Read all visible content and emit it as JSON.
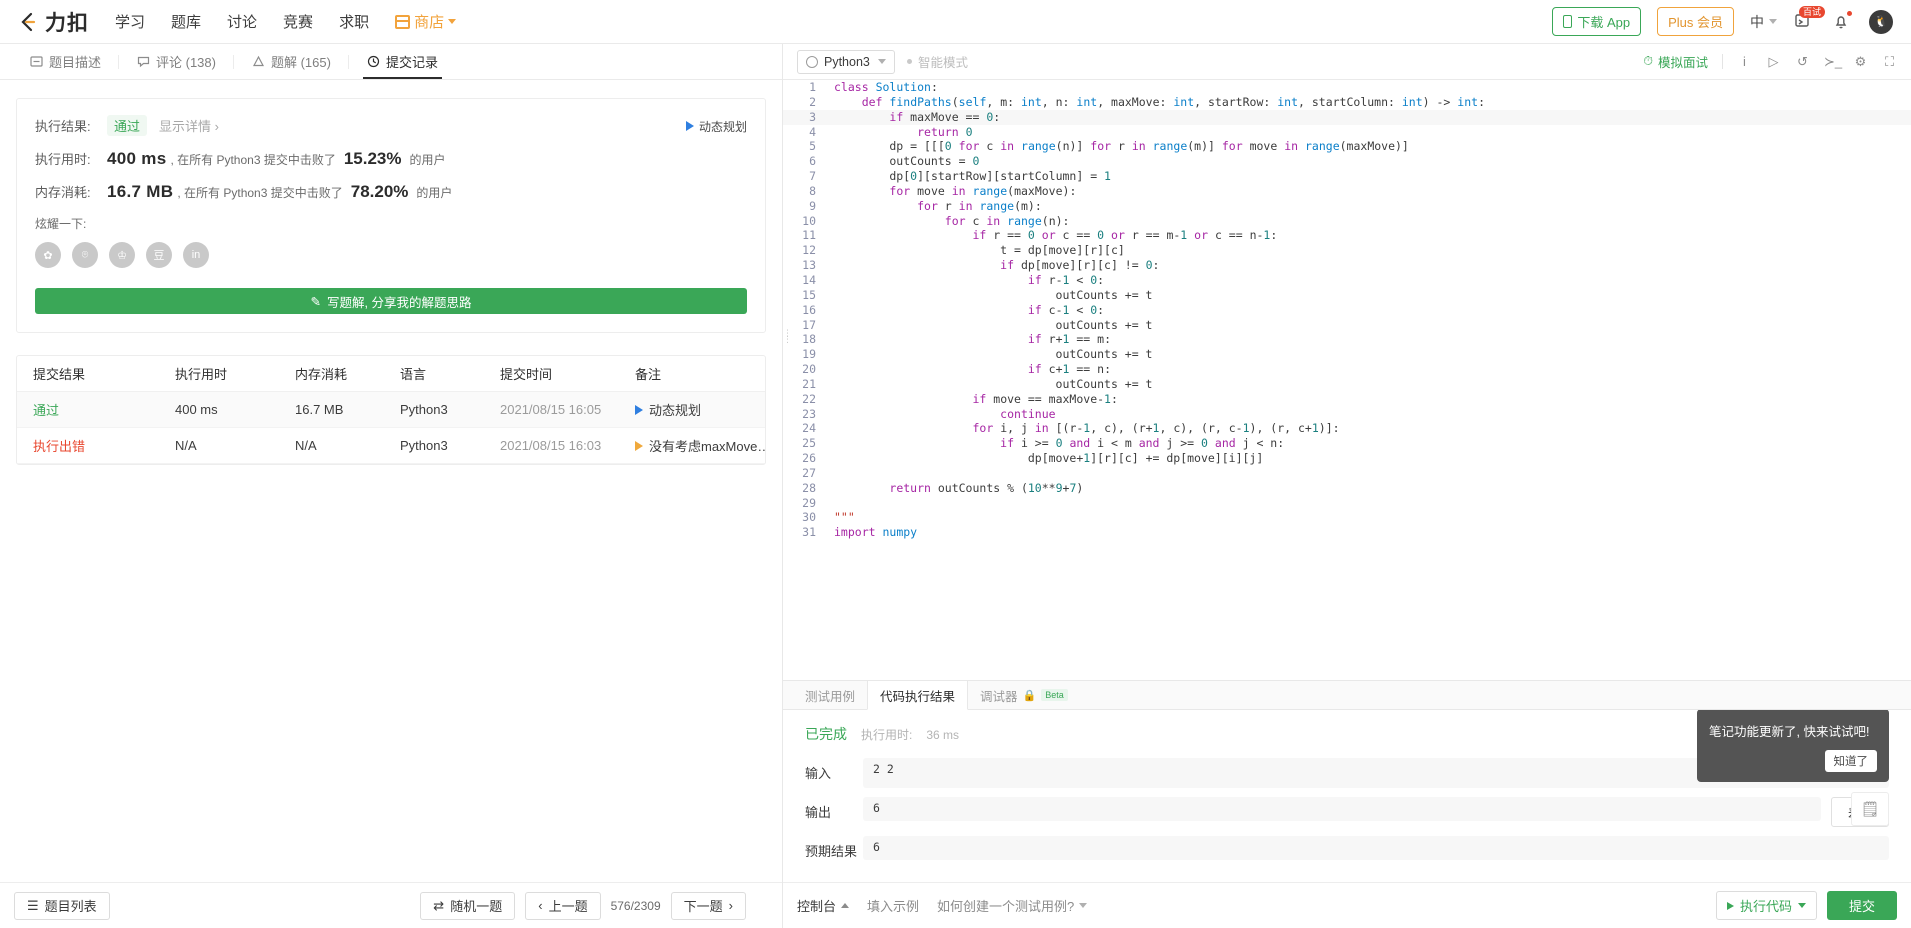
{
  "header": {
    "brand": "力扣",
    "nav": [
      "学习",
      "题库",
      "讨论",
      "竞赛",
      "求职"
    ],
    "shop": "商店",
    "download_app": "下载 App",
    "plus": "Plus 会员",
    "lang": "中",
    "notif_badge": "百试",
    "accent_green": "#3aa757",
    "accent_orange": "#f0a33c"
  },
  "left_tabs": [
    {
      "label": "题目描述",
      "icon": "description-icon",
      "active": false
    },
    {
      "label": "评论 (138)",
      "icon": "comment-icon",
      "active": false
    },
    {
      "label": "题解 (165)",
      "icon": "solution-icon",
      "active": false
    },
    {
      "label": "提交记录",
      "icon": "clock-icon",
      "active": true
    }
  ],
  "result": {
    "result_label": "执行结果:",
    "result_value": "通过",
    "detail_link": "显示详情 ›",
    "time_label": "执行用时:",
    "time_value": "400 ms",
    "time_mid": ", 在所有 Python3 提交中击败了",
    "time_pct": "15.23%",
    "time_suffix": "的用户",
    "mem_label": "内存消耗:",
    "mem_value": "16.7 MB",
    "mem_mid": ", 在所有 Python3 提交中击败了",
    "mem_pct": "78.20%",
    "mem_suffix": "的用户",
    "tag": "动态规划",
    "share_label": "炫耀一下:",
    "share_icons": [
      "wechat-icon",
      "weibo-icon",
      "qq-icon",
      "douban-icon",
      "linkedin-icon"
    ],
    "share_glyphs": [
      "✿",
      "⌾",
      "♔",
      "豆",
      "in"
    ],
    "write_banner": "写题解, 分享我的解题思路"
  },
  "table": {
    "headers": [
      "提交结果",
      "执行用时",
      "内存消耗",
      "语言",
      "提交时间",
      "备注"
    ],
    "rows": [
      {
        "status": "通过",
        "status_type": "pass",
        "runtime": "400 ms",
        "memory": "16.7 MB",
        "language": "Python3",
        "time": "2021/08/15 16:05",
        "note": "动态规划",
        "note_flag": "blue"
      },
      {
        "status": "执行出错",
        "status_type": "error",
        "runtime": "N/A",
        "memory": "N/A",
        "language": "Python3",
        "time": "2021/08/15 16:03",
        "note": "没有考虑maxMove…",
        "note_flag": "orange"
      }
    ]
  },
  "left_footer": {
    "problem_list": "题目列表",
    "random": "随机一题",
    "prev": "上一题",
    "page": "576/2309",
    "next": "下一题"
  },
  "editor": {
    "language": "Python3",
    "smart_mode": "智能模式",
    "mock_interview": "模拟面试",
    "icons": [
      "info-icon",
      "play-icon",
      "reset-icon",
      "console-icon",
      "settings-icon",
      "fullscreen-icon"
    ],
    "icon_glyphs": [
      "i",
      "▷",
      "↺",
      "≻_",
      "⚙",
      "⛶"
    ],
    "code_lines": [
      {
        "n": 1,
        "text": "class Solution:"
      },
      {
        "n": 2,
        "text": "    def findPaths(self, m: int, n: int, maxMove: int, startRow: int, startColumn: int) -> int:"
      },
      {
        "n": 3,
        "text": "        if maxMove == 0:"
      },
      {
        "n": 4,
        "text": "            return 0"
      },
      {
        "n": 5,
        "text": "        dp = [[[0 for c in range(n)] for r in range(m)] for move in range(maxMove)]"
      },
      {
        "n": 6,
        "text": "        outCounts = 0"
      },
      {
        "n": 7,
        "text": "        dp[0][startRow][startColumn] = 1"
      },
      {
        "n": 8,
        "text": "        for move in range(maxMove):"
      },
      {
        "n": 9,
        "text": "            for r in range(m):"
      },
      {
        "n": 10,
        "text": "                for c in range(n):"
      },
      {
        "n": 11,
        "text": "                    if r == 0 or c == 0 or r == m-1 or c == n-1:"
      },
      {
        "n": 12,
        "text": "                        t = dp[move][r][c]"
      },
      {
        "n": 13,
        "text": "                        if dp[move][r][c] != 0:"
      },
      {
        "n": 14,
        "text": "                            if r-1 < 0:"
      },
      {
        "n": 15,
        "text": "                                outCounts += t"
      },
      {
        "n": 16,
        "text": "                            if c-1 < 0:"
      },
      {
        "n": 17,
        "text": "                                outCounts += t"
      },
      {
        "n": 18,
        "text": "                            if r+1 == m:"
      },
      {
        "n": 19,
        "text": "                                outCounts += t"
      },
      {
        "n": 20,
        "text": "                            if c+1 == n:"
      },
      {
        "n": 21,
        "text": "                                outCounts += t"
      },
      {
        "n": 22,
        "text": "                    if move == maxMove-1:"
      },
      {
        "n": 23,
        "text": "                        continue"
      },
      {
        "n": 24,
        "text": "                    for i, j in [(r-1, c), (r+1, c), (r, c-1), (r, c+1)]:"
      },
      {
        "n": 25,
        "text": "                        if i >= 0 and i < m and j >= 0 and j < n:"
      },
      {
        "n": 26,
        "text": "                            dp[move+1][r][c] += dp[move][i][j]"
      },
      {
        "n": 27,
        "text": ""
      },
      {
        "n": 28,
        "text": "        return outCounts % (10**9+7)"
      },
      {
        "n": 29,
        "text": ""
      },
      {
        "n": 30,
        "text": "\"\"\""
      },
      {
        "n": 31,
        "text": "import numpy"
      }
    ]
  },
  "console": {
    "tabs": [
      {
        "label": "测试用例",
        "active": false
      },
      {
        "label": "代码执行结果",
        "active": true
      },
      {
        "label": "调试器",
        "active": false,
        "badge": "Beta",
        "lock": true
      }
    ],
    "status": "已完成",
    "runtime_label": "执行用时:",
    "runtime_value": "36 ms",
    "input_label": "输入",
    "input_value": "2\n2",
    "output_label": "输出",
    "output_value": "6",
    "expected_label": "预期结果",
    "expected_value": "6",
    "diff_button": "差别"
  },
  "right_footer": {
    "console_toggle": "控制台",
    "fill_example": "填入示例",
    "how_to": "如何创建一个测试用例?",
    "run": "执行代码",
    "submit": "提交"
  },
  "toast": {
    "message": "笔记功能更新了, 快来试试吧!",
    "button": "知道了",
    "note_icon": "note-icon"
  }
}
